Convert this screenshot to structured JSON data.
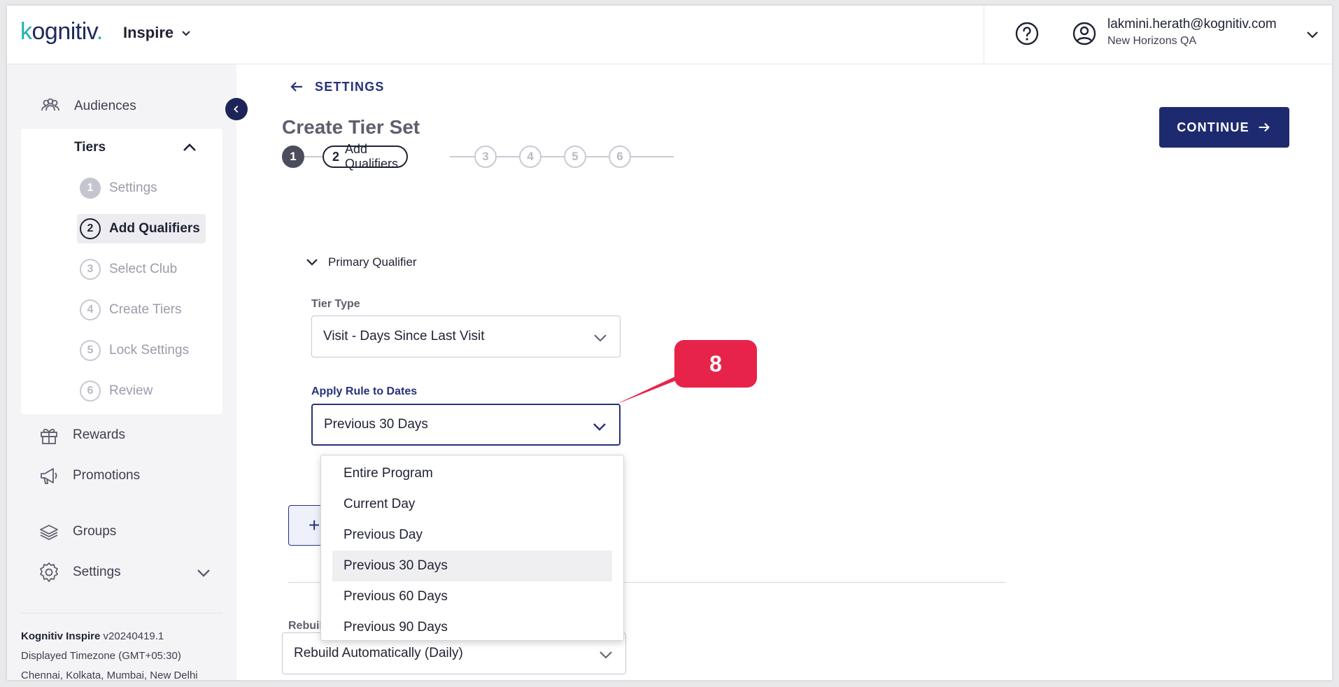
{
  "header": {
    "logo_text_k": "k",
    "logo_text_rest": "ognitiv",
    "logo_dot": ".",
    "app_name": "Inspire",
    "user_email": "lakmini.herath@kognitiv.com",
    "user_org": "New Horizons QA"
  },
  "sidebar": {
    "audiences": "Audiences",
    "tiers_label": "Tiers",
    "steps": [
      {
        "num": "1",
        "label": "Settings"
      },
      {
        "num": "2",
        "label": "Add Qualifiers"
      },
      {
        "num": "3",
        "label": "Select Club"
      },
      {
        "num": "4",
        "label": "Create Tiers"
      },
      {
        "num": "5",
        "label": "Lock Settings"
      },
      {
        "num": "6",
        "label": "Review"
      }
    ],
    "rewards": "Rewards",
    "promotions": "Promotions",
    "groups": "Groups",
    "settings": "Settings",
    "footer": {
      "product": "Kognitiv Inspire",
      "version": "v20240419.1",
      "timezone": "Displayed Timezone (GMT+05:30)",
      "cities": "Chennai, Kolkata, Mumbai, New Delhi"
    }
  },
  "main": {
    "back_label": "SETTINGS",
    "title": "Create Tier Set",
    "continue_label": "CONTINUE",
    "stepper": {
      "step1": "1",
      "current_num": "2",
      "current_label": "Add Qualifiers",
      "step3": "3",
      "step4": "4",
      "step5": "5",
      "step6": "6"
    },
    "section_title": "Primary Qualifier",
    "tier_type_label": "Tier Type",
    "tier_type_value": "Visit - Days Since Last Visit",
    "apply_rule_label": "Apply Rule to Dates",
    "apply_rule_value": "Previous 30 Days",
    "dropdown_options": [
      "Entire Program",
      "Current Day",
      "Previous Day",
      "Previous 30 Days",
      "Previous 60 Days",
      "Previous 90 Days"
    ],
    "add_symbol": "+",
    "rebuild_label": "Rebuild",
    "rebuild_value": "Rebuild Automatically (Daily)"
  },
  "callout": {
    "number": "8",
    "color": "#e8234a"
  },
  "colors": {
    "primary": "#1e2a70",
    "teal": "#21b1b0"
  }
}
